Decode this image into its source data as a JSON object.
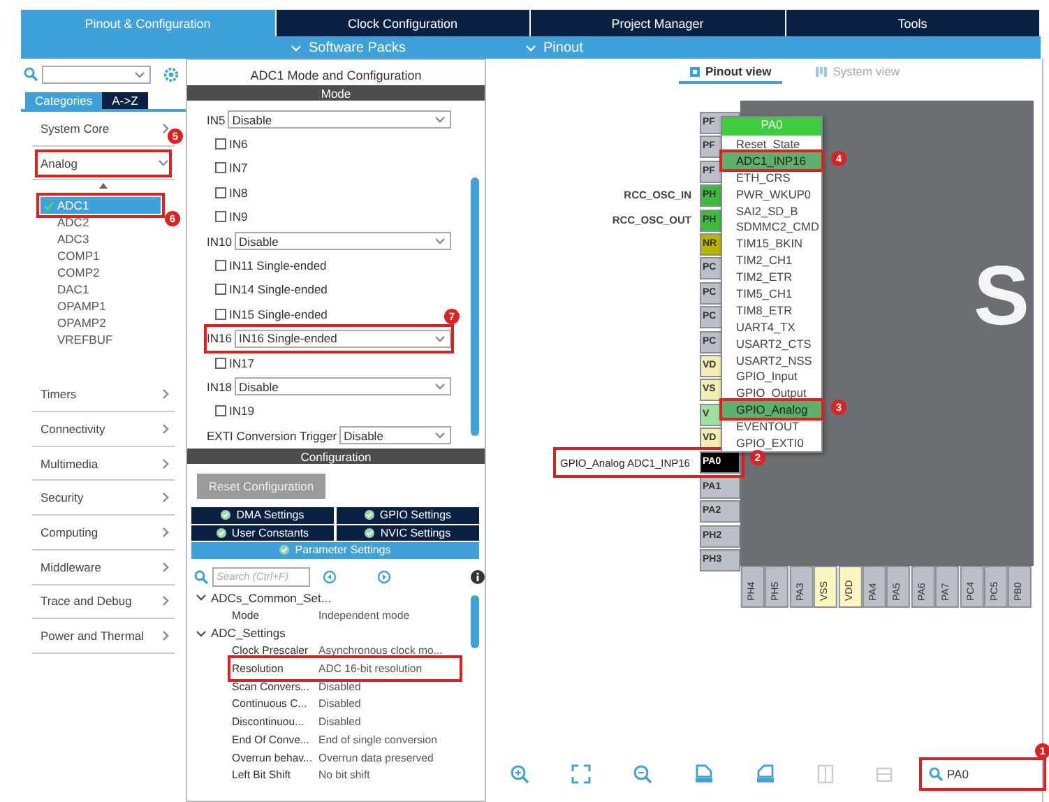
{
  "top_tabs": [
    {
      "label": "Pinout & Configuration",
      "selected": true
    },
    {
      "label": "Clock Configuration",
      "selected": false
    },
    {
      "label": "Project Manager",
      "selected": false
    },
    {
      "label": "Tools",
      "selected": false
    }
  ],
  "sub_bar": [
    {
      "label": "Software Packs"
    },
    {
      "label": "Pinout"
    }
  ],
  "sidebar": {
    "tabs": [
      {
        "label": "Categories",
        "selected": true
      },
      {
        "label": "A->Z",
        "selected": false
      }
    ],
    "categories": [
      {
        "label": "System Core",
        "expanded": false
      },
      {
        "label": "Analog",
        "expanded": true,
        "highlighted": true,
        "annotation": "5",
        "children": [
          {
            "label": "ADC1",
            "selected": true,
            "checked": true,
            "annotation": "6"
          },
          {
            "label": "ADC2",
            "selected": false,
            "checked": false
          },
          {
            "label": "ADC3",
            "selected": false,
            "checked": false
          },
          {
            "label": "COMP1",
            "selected": false,
            "checked": false
          },
          {
            "label": "COMP2",
            "selected": false,
            "checked": false
          },
          {
            "label": "DAC1",
            "selected": false,
            "checked": false
          },
          {
            "label": "OPAMP1",
            "selected": false,
            "checked": false
          },
          {
            "label": "OPAMP2",
            "selected": false,
            "checked": false
          },
          {
            "label": "VREFBUF",
            "selected": false,
            "checked": false
          }
        ]
      },
      {
        "label": "Timers",
        "expanded": false
      },
      {
        "label": "Connectivity",
        "expanded": false
      },
      {
        "label": "Multimedia",
        "expanded": false
      },
      {
        "label": "Security",
        "expanded": false
      },
      {
        "label": "Computing",
        "expanded": false
      },
      {
        "label": "Middleware",
        "expanded": false
      },
      {
        "label": "Trace and Debug",
        "expanded": false
      },
      {
        "label": "Power and Thermal",
        "expanded": false
      }
    ]
  },
  "middle": {
    "title": "ADC1 Mode and Configuration",
    "mode_header": "Mode",
    "mode_rows": [
      {
        "kind": "select",
        "label": "IN5",
        "value": "Disable"
      },
      {
        "kind": "checkbox",
        "label": "IN6",
        "checked": false
      },
      {
        "kind": "checkbox",
        "label": "IN7",
        "checked": false
      },
      {
        "kind": "checkbox",
        "label": "IN8",
        "checked": false
      },
      {
        "kind": "checkbox",
        "label": "IN9",
        "checked": false
      },
      {
        "kind": "select",
        "label": "IN10",
        "value": "Disable"
      },
      {
        "kind": "checkbox",
        "label": "IN11 Single-ended",
        "checked": false
      },
      {
        "kind": "checkbox",
        "label": "IN14 Single-ended",
        "checked": false
      },
      {
        "kind": "checkbox",
        "label": "IN15 Single-ended",
        "checked": false
      },
      {
        "kind": "select",
        "label": "IN16",
        "value": "IN16 Single-ended",
        "annotation": "7"
      },
      {
        "kind": "checkbox",
        "label": "IN17",
        "checked": false
      },
      {
        "kind": "select",
        "label": "IN18",
        "value": "Disable"
      },
      {
        "kind": "checkbox",
        "label": "IN19",
        "checked": false
      },
      {
        "kind": "select",
        "label": "EXTI Conversion Trigger",
        "value": "Disable"
      }
    ],
    "config_header": "Configuration",
    "reset_button": {
      "label": "Reset Configuration",
      "disabled": true
    },
    "config_tabs": [
      {
        "label": "DMA Settings",
        "selected": false
      },
      {
        "label": "GPIO Settings",
        "selected": false
      },
      {
        "label": "User Constants",
        "selected": false
      },
      {
        "label": "NVIC Settings",
        "selected": false
      },
      {
        "label": "Parameter Settings",
        "selected": true
      }
    ],
    "param_search": {
      "placeholder": "Search (Ctrl+F)"
    },
    "param_tree": [
      {
        "label": "ADCs_Common_Set...",
        "expanded": true,
        "children": [
          {
            "name": "Mode",
            "value": "Independent mode"
          }
        ]
      },
      {
        "label": "ADC_Settings",
        "expanded": true,
        "children": [
          {
            "name": "Clock Prescaler",
            "value": "Asynchronous clock mo..."
          },
          {
            "name": "Resolution",
            "value": "ADC 16-bit resolution",
            "highlighted": true
          },
          {
            "name": "Scan Convers...",
            "value": "Disabled"
          },
          {
            "name": "Continuous C...",
            "value": "Disabled"
          },
          {
            "name": "Discontinuou...",
            "value": "Disabled"
          },
          {
            "name": "End Of Conve...",
            "value": "End of single conversion"
          },
          {
            "name": "Overrun behav...",
            "value": "Overrun data preserved"
          },
          {
            "name": "Left Bit Shift",
            "value": "No bit shift"
          }
        ]
      }
    ]
  },
  "pinout": {
    "view_tabs": [
      {
        "label": "Pinout view",
        "selected": true
      },
      {
        "label": "System view",
        "selected": false
      }
    ],
    "chip_text": "S",
    "left_pins": [
      {
        "label": "PF",
        "color": "#b9c0c7"
      },
      {
        "label": "PF",
        "color": "#b9c0c7"
      },
      {
        "label": "PF",
        "color": "#b9c0c7"
      },
      {
        "label": "PH",
        "color": "#3dbb3d",
        "signal": "RCC_OSC_IN"
      },
      {
        "label": "PH",
        "color": "#3dbb3d",
        "signal": "RCC_OSC_OUT"
      },
      {
        "label": "NR",
        "color": "#b8b400"
      },
      {
        "label": "PC",
        "color": "#b9c0c7"
      },
      {
        "label": "PC",
        "color": "#b9c0c7"
      },
      {
        "label": "PC",
        "color": "#b9c0c7"
      },
      {
        "label": "PC",
        "color": "#b9c0c7"
      },
      {
        "label": "VD",
        "color": "#f3eeb5"
      },
      {
        "label": "VS",
        "color": "#f3eeb5"
      },
      {
        "label": "V",
        "color": "#9fe0a0"
      },
      {
        "label": "VD",
        "color": "#f3eeb5"
      },
      {
        "label": "PA0",
        "color": "#000000",
        "signal": "GPIO_Analog ADC1_INP16",
        "annotation": "2"
      },
      {
        "label": "PA1",
        "color": "#b9c0c7"
      },
      {
        "label": "PA2",
        "color": "#b9c0c7"
      },
      {
        "label": "PH2",
        "color": "#b9c0c7"
      },
      {
        "label": "PH3",
        "color": "#b9c0c7"
      }
    ],
    "bottom_pins": [
      {
        "label": "PH4",
        "color": "#b9c0c7"
      },
      {
        "label": "PH5",
        "color": "#b9c0c7"
      },
      {
        "label": "PA3",
        "color": "#b9c0c7"
      },
      {
        "label": "VSS",
        "color": "#fbf5c0"
      },
      {
        "label": "VDD",
        "color": "#fbf5c0"
      },
      {
        "label": "PA4",
        "color": "#b9c0c7"
      },
      {
        "label": "PA5",
        "color": "#b9c0c7"
      },
      {
        "label": "PA6",
        "color": "#b9c0c7"
      },
      {
        "label": "PA7",
        "color": "#b9c0c7"
      },
      {
        "label": "PC4",
        "color": "#b9c0c7"
      },
      {
        "label": "PC5",
        "color": "#b9c0c7"
      },
      {
        "label": "PB0",
        "color": "#b9c0c7"
      }
    ],
    "pin_menu": {
      "title": "PA0",
      "items": [
        {
          "label": "Reset_State",
          "selected": false
        },
        {
          "label": "ADC1_INP16",
          "selected": true,
          "annotation": "4"
        },
        {
          "label": "ETH_CRS",
          "selected": false
        },
        {
          "label": "PWR_WKUP0",
          "selected": false
        },
        {
          "label": "SAI2_SD_B",
          "selected": false
        },
        {
          "label": "SDMMC2_CMD",
          "selected": false
        },
        {
          "label": "TIM15_BKIN",
          "selected": false
        },
        {
          "label": "TIM2_CH1",
          "selected": false
        },
        {
          "label": "TIM2_ETR",
          "selected": false
        },
        {
          "label": "TIM5_CH1",
          "selected": false
        },
        {
          "label": "TIM8_ETR",
          "selected": false
        },
        {
          "label": "UART4_TX",
          "selected": false
        },
        {
          "label": "USART2_CTS",
          "selected": false
        },
        {
          "label": "USART2_NSS",
          "selected": false
        },
        {
          "label": "GPIO_Input",
          "selected": false
        },
        {
          "label": "GPIO_Output",
          "selected": false
        },
        {
          "label": "GPIO_Analog",
          "selected": true,
          "annotation": "3"
        },
        {
          "label": "EVENTOUT",
          "selected": false
        },
        {
          "label": "GPIO_EXTI0",
          "selected": false
        }
      ]
    },
    "find_field": {
      "value": "PA0",
      "annotation": "1"
    }
  }
}
